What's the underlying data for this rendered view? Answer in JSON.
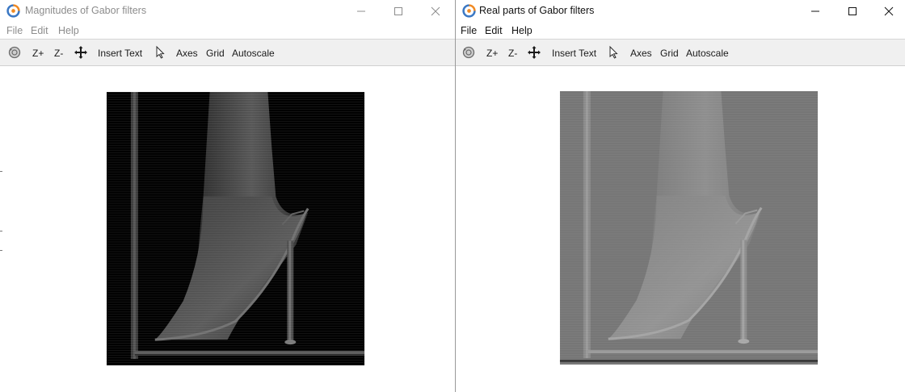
{
  "windows": [
    {
      "title": "Magnitudes of Gabor filters",
      "state": "inactive",
      "menu": [
        "File",
        "Edit",
        "Help"
      ],
      "toolbar": {
        "rotate_icon": "rotate-3d-icon",
        "zoom_in": "Z+",
        "zoom_out": "Z-",
        "pan_icon": "pan-move-icon",
        "insert_text": "Insert Text",
        "pointer_icon": "pointer-icon",
        "axes": "Axes",
        "grid": "Grid",
        "autoscale": "Autoscale"
      },
      "image": {
        "description_kind": "gabor-magnitude",
        "background": "#000000"
      }
    },
    {
      "title": "Real parts of Gabor filters",
      "state": "active",
      "menu": [
        "File",
        "Edit",
        "Help"
      ],
      "toolbar": {
        "rotate_icon": "rotate-3d-icon",
        "zoom_in": "Z+",
        "zoom_out": "Z-",
        "pan_icon": "pan-move-icon",
        "insert_text": "Insert Text",
        "pointer_icon": "pointer-icon",
        "axes": "Axes",
        "grid": "Grid",
        "autoscale": "Autoscale"
      },
      "image": {
        "description_kind": "gabor-real-part",
        "background": "#767676"
      }
    }
  ],
  "colors": {
    "inactive_text": "#8c8c8c",
    "active_text": "#111111",
    "toolbar_bg": "#f0f0f0"
  }
}
